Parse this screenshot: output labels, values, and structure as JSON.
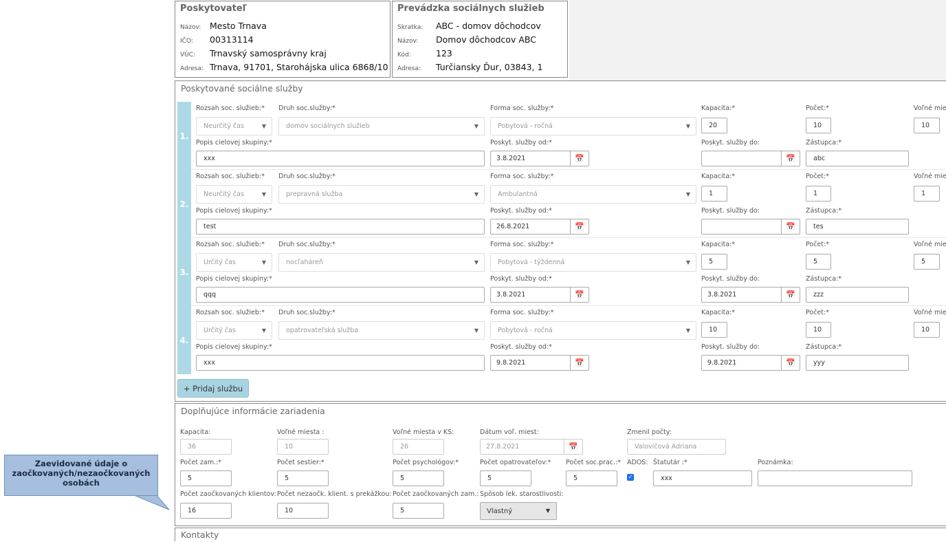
{
  "provider": {
    "title": "Poskytovateľ",
    "rows": [
      {
        "label": "Názov:",
        "value": "Mesto Trnava"
      },
      {
        "label": "IČO:",
        "value": "00313114"
      },
      {
        "label": "VÚC:",
        "value": "Trnavský samosprávny kraj"
      },
      {
        "label": "Adresa:",
        "value": "Trnava, 91701, Starohájska ulica 6868/10"
      }
    ]
  },
  "facility": {
    "title": "Prevádzka sociálnych služieb",
    "rows": [
      {
        "label": "Skratka:",
        "value": "ABC - domov dôchodcov"
      },
      {
        "label": "Názov:",
        "value": "Domov dôchodcov ABC"
      },
      {
        "label": "Kód:",
        "value": "123"
      },
      {
        "label": "Adresa:",
        "value": "Turčiansky Ďur, 03843, 1"
      }
    ]
  },
  "services": {
    "title": "Poskytované sociálne služby",
    "labels": {
      "rozsah": "Rozsah soc. služieb:",
      "druh": "Druh soc.služby:",
      "forma": "Forma soc. služby:",
      "kapacita": "Kapacita:",
      "pocet": "Počet:",
      "volne": "Voľné mies",
      "popis": "Popis cielovej skupiny:",
      "od": "Poskyt. služby od:",
      "do": "Poskyt. služby do:",
      "zastupca": "Zástupca:",
      "required": "*"
    },
    "rows": [
      {
        "num": "1.",
        "rozsah": "Neurčitý čas",
        "druh": "domov sociálnych služieb",
        "forma": "Pobytová - ročná",
        "kapacita": "20",
        "pocet": "10",
        "volne": "10",
        "popis": "xxx",
        "od": "3.8.2021",
        "do": "",
        "zastupca": "abc"
      },
      {
        "num": "2.",
        "rozsah": "Neurčitý čas",
        "druh": "prepravná služba",
        "forma": "Ambulantná",
        "kapacita": "1",
        "pocet": "1",
        "volne": "1",
        "popis": "test",
        "od": "26.8.2021",
        "do": "",
        "zastupca": "tes"
      },
      {
        "num": "3.",
        "rozsah": "Určitý čas",
        "druh": "nocľaháreň",
        "forma": "Pobytová - týždenná",
        "kapacita": "5",
        "pocet": "5",
        "volne": "5",
        "popis": "qqq",
        "od": "3.8.2021",
        "do": "3.8.2021",
        "zastupca": "zzz"
      },
      {
        "num": "4.",
        "rozsah": "Určitý čas",
        "druh": "opatrovateľská služba",
        "forma": "Pobytová - ročná",
        "kapacita": "10",
        "pocet": "10",
        "volne": "10",
        "popis": "xxx",
        "od": "9.8.2021",
        "do": "9.8.2021",
        "zastupca": "yyy"
      }
    ],
    "add_button": "+ Pridaj službu"
  },
  "extra": {
    "title": "Doplňujúce informácie zariadenia",
    "kapacita_label": "Kapacita:",
    "kapacita": "36",
    "volne_label": "Voľné miesta :",
    "volne": "10",
    "volne_ks_label": "Voľné miesta v KS:",
    "volne_ks": "26",
    "datum_label": "Dátum voľ. miest:",
    "datum": "27.8.2021",
    "zmenil_label": "Zmenil počty:",
    "zmenil": "Valovičová Adriana",
    "zam_label": "Počet zam.:",
    "zam": "5",
    "sestier_label": "Počet sestier:",
    "sestier": "5",
    "psych_label": "Počet psychológov:",
    "psych": "5",
    "opatr_label": "Počet opatrovateľov:",
    "opatr": "5",
    "socprac_label": "Počet soc.prac.:",
    "socprac": "5",
    "ados_label": "ADOS:",
    "statutar_label": "Štatutár :",
    "statutar": "xxx",
    "poznamka_label": "Poznámka:",
    "poznamka": "",
    "zaock_label": "Počet zaočkovaných klientov:",
    "zaock": "16",
    "nezaock_label": "Počet nezaočk. klient. s prekážkou:",
    "nezaock": "10",
    "zaock_zam_label": "Počet zaočkovaných zam.:",
    "zaock_zam": "5",
    "sposob_label": "Spôsob lek. starostlivosti:",
    "sposob": "Vlastný",
    "required": "*"
  },
  "callout": "Zaevidované údaje o zaočkovaných/nezaočkovaných osobách",
  "next_section": "Kontakty"
}
